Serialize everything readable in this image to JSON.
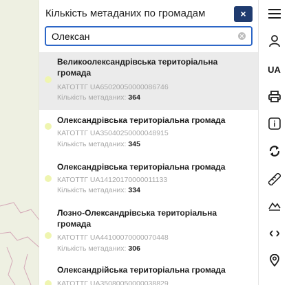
{
  "panel": {
    "title": "Кількість метаданих по громадам",
    "close_label": "×"
  },
  "search": {
    "value": "Олексан",
    "placeholder": ""
  },
  "results": [
    {
      "name": "Великоолександрівська територіальна громада",
      "code_label": "КАТОТТГ",
      "code": "UA65020050000086746",
      "count_label": "Кількість метаданих:",
      "count": "364"
    },
    {
      "name": "Олександрівська територіальна громада",
      "code_label": "КАТОТТГ",
      "code": "UA35040250000048915",
      "count_label": "Кількість метаданих:",
      "count": "345"
    },
    {
      "name": "Олександрівська територіальна громада",
      "code_label": "КАТОТТГ",
      "code": "UA14120170000011133",
      "count_label": "Кількість метаданих:",
      "count": "334"
    },
    {
      "name": "Лозно-Олександрівська територіальна громада",
      "code_label": "КАТОТТГ",
      "code": "UA44100070000070448",
      "count_label": "Кількість метаданих:",
      "count": "306"
    },
    {
      "name": "Олександрійська територіальна громада",
      "code_label": "КАТОТТГ",
      "code": "UA35080050000038829",
      "count_label": "",
      "count": ""
    }
  ],
  "toolbar": {
    "language": "UA",
    "icons": [
      "menu-icon",
      "user-icon",
      "language",
      "print-icon",
      "info-icon",
      "refresh-icon",
      "ruler-icon",
      "elevation-profile-icon",
      "code-icon",
      "location-pin-icon"
    ]
  },
  "colors": {
    "accent": "#1f3b6f",
    "search_border": "#2c66c7",
    "selected_bg": "#ebebeb",
    "dot": "#eff5b0"
  }
}
